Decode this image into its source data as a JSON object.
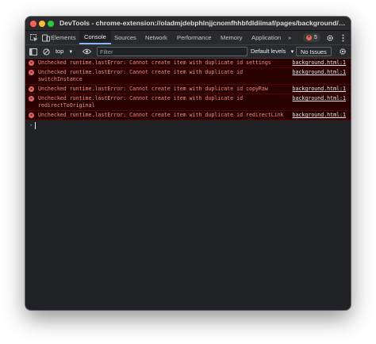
{
  "window": {
    "title": "DevTools - chrome-extension://oladmjdebphlnjjcnomfhhbfdldiimaf/pages/background/backgroun..."
  },
  "tabs": [
    {
      "label": "Elements",
      "active": false
    },
    {
      "label": "Console",
      "active": true
    },
    {
      "label": "Sources",
      "active": false
    },
    {
      "label": "Network",
      "active": false
    },
    {
      "label": "Performance",
      "active": false
    },
    {
      "label": "Memory",
      "active": false
    },
    {
      "label": "Application",
      "active": false
    }
  ],
  "tabbar": {
    "more": "»",
    "error_count": "5"
  },
  "toolbar": {
    "context": "top",
    "filter_placeholder": "Filter",
    "levels": "Default levels",
    "issues": "No Issues"
  },
  "messages": [
    {
      "text": "Unchecked runtime.lastError: Cannot create item with duplicate id settings",
      "source": "background.html:1"
    },
    {
      "text": "Unchecked runtime.lastError: Cannot create item with duplicate id switchInstance",
      "source": "background.html:1"
    },
    {
      "text": "Unchecked runtime.lastError: Cannot create item with duplicate id copyRaw",
      "source": "background.html:1"
    },
    {
      "text": "Unchecked runtime.lastError: Cannot create item with duplicate id redirectToOriginal",
      "source": "background.html:1"
    },
    {
      "text": "Unchecked runtime.lastError: Cannot create item with duplicate id redirectLink",
      "source": "background.html:1"
    }
  ],
  "colors": {
    "error_text": "#f28b82",
    "error_bg": "#290000",
    "accent": "#8ab4f8"
  }
}
